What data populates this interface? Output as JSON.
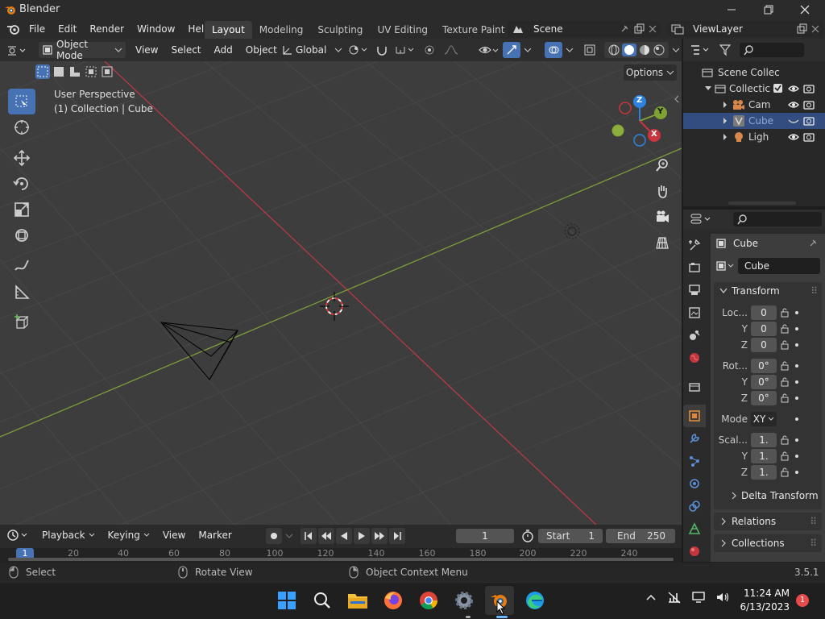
{
  "window": {
    "title": "Blender"
  },
  "menubar": {
    "menus": [
      "File",
      "Edit",
      "Render",
      "Window",
      "Help"
    ],
    "workspaces": [
      "Layout",
      "Modeling",
      "Sculpting",
      "UV Editing",
      "Texture Paint",
      "Sh"
    ],
    "active_workspace": "Layout",
    "scene": "Scene",
    "view_layer": "ViewLayer"
  },
  "viewport_header": {
    "mode": "Object Mode",
    "menus": [
      "View",
      "Select",
      "Add",
      "Object"
    ],
    "orientation": "Global",
    "options": "Options"
  },
  "viewport": {
    "perspective": "User Perspective",
    "collection": "(1) Collection | Cube",
    "gizmo": {
      "x": "X",
      "y": "Y",
      "z": "Z"
    }
  },
  "outliner": {
    "items": [
      {
        "label": "Scene Collec",
        "kind": "scene"
      },
      {
        "label": "Collectic",
        "kind": "collection"
      },
      {
        "label": "Cam",
        "kind": "camera"
      },
      {
        "label": "Cube",
        "kind": "mesh",
        "selected": true
      },
      {
        "label": "Ligh",
        "kind": "light"
      }
    ]
  },
  "properties": {
    "object_name": "Cube",
    "data_name": "Cube",
    "transform_title": "Transform",
    "location_label": "Loc...",
    "location": [
      "0",
      "0",
      "0"
    ],
    "rotation_label": "Rot...",
    "rotation": [
      "0°",
      "0°",
      "0°"
    ],
    "mode_label": "Mode",
    "mode_value": "XY",
    "scale_label": "Scal...",
    "scale": [
      "1.",
      "1.",
      "1."
    ],
    "axis_y": "Y",
    "axis_z": "Z",
    "sections": [
      "Delta Transform",
      "Relations",
      "Collections"
    ]
  },
  "timeline": {
    "menus": [
      "Playback",
      "Keying",
      "View",
      "Marker"
    ],
    "current_frame": "1",
    "start_label": "Start",
    "start": "1",
    "end_label": "End",
    "end": "250",
    "ruler": [
      "1",
      "20",
      "40",
      "60",
      "80",
      "100",
      "120",
      "140",
      "160",
      "180",
      "200",
      "220",
      "240"
    ]
  },
  "statusbar": {
    "select": "Select",
    "rotate": "Rotate View",
    "context": "Object Context Menu",
    "version": "3.5.1"
  },
  "taskbar": {
    "time": "11:24 AM",
    "date": "6/13/2023",
    "notifications": "1"
  },
  "colors": {
    "accent": "#4772b3",
    "x_axis": "#c9353e",
    "y_axis": "#7ea333",
    "z_axis": "#2d83e0"
  }
}
